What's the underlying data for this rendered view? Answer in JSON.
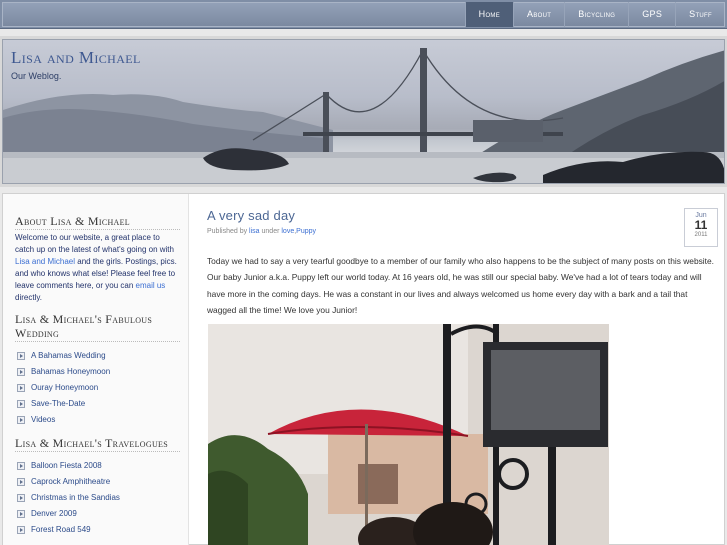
{
  "nav": {
    "items": [
      "Home",
      "About",
      "Bicycling",
      "GPS",
      "Stuff"
    ],
    "active": "Home"
  },
  "site": {
    "title": "Lisa and Michael",
    "tagline": "Our Weblog."
  },
  "sidebar": {
    "about": {
      "heading": "About Lisa & Michael",
      "text_before_link1": "Welcome to our website, a great place to catch up on the latest of what's going on with ",
      "link1": "Lisa and Michael",
      "text_between": " and the girls. Postings, pics. and who knows what else! Please feel free to leave comments here, or you can ",
      "link2": "email us",
      "text_after": " directly."
    },
    "wedding": {
      "heading": "Lisa & Michael's Fabulous Wedding",
      "items": [
        "A Bahamas Wedding",
        "Bahamas Honeymoon",
        "Ouray Honeymoon",
        "Save-The-Date",
        "Videos"
      ]
    },
    "travelogues": {
      "heading": "Lisa & Michael's Travelogues",
      "items": [
        "Balloon Fiesta 2008",
        "Caprock Amphitheatre",
        "Christmas in the Sandias",
        "Denver 2009",
        "Forest Road 549"
      ]
    }
  },
  "post": {
    "title": "A very sad day",
    "meta_prefix": "Published by",
    "author": "lisa",
    "meta_under": "under",
    "category": "love",
    "tag": "Puppy",
    "date": {
      "month": "Jun",
      "day": "11",
      "year": "2011"
    },
    "body": "Today we had to say a very tearful goodbye to a member of our family who also happens to be the subject of many posts on this website. Our baby Junior a.k.a. Puppy left our world today. At 16 years old, he was still our special baby. We've had a lot of tears today and will have more in the coming days. He was a constant in our lives and always welcomed us home every day with a bark and a tail that wagged all the time! We love you Junior!"
  },
  "colors": {
    "nav_bar": "#7f8ea6",
    "nav_active": "#4f5f78",
    "title_blue": "#3e5890",
    "link_blue": "#3c6fd2",
    "umbrella_red": "#c8243a"
  }
}
